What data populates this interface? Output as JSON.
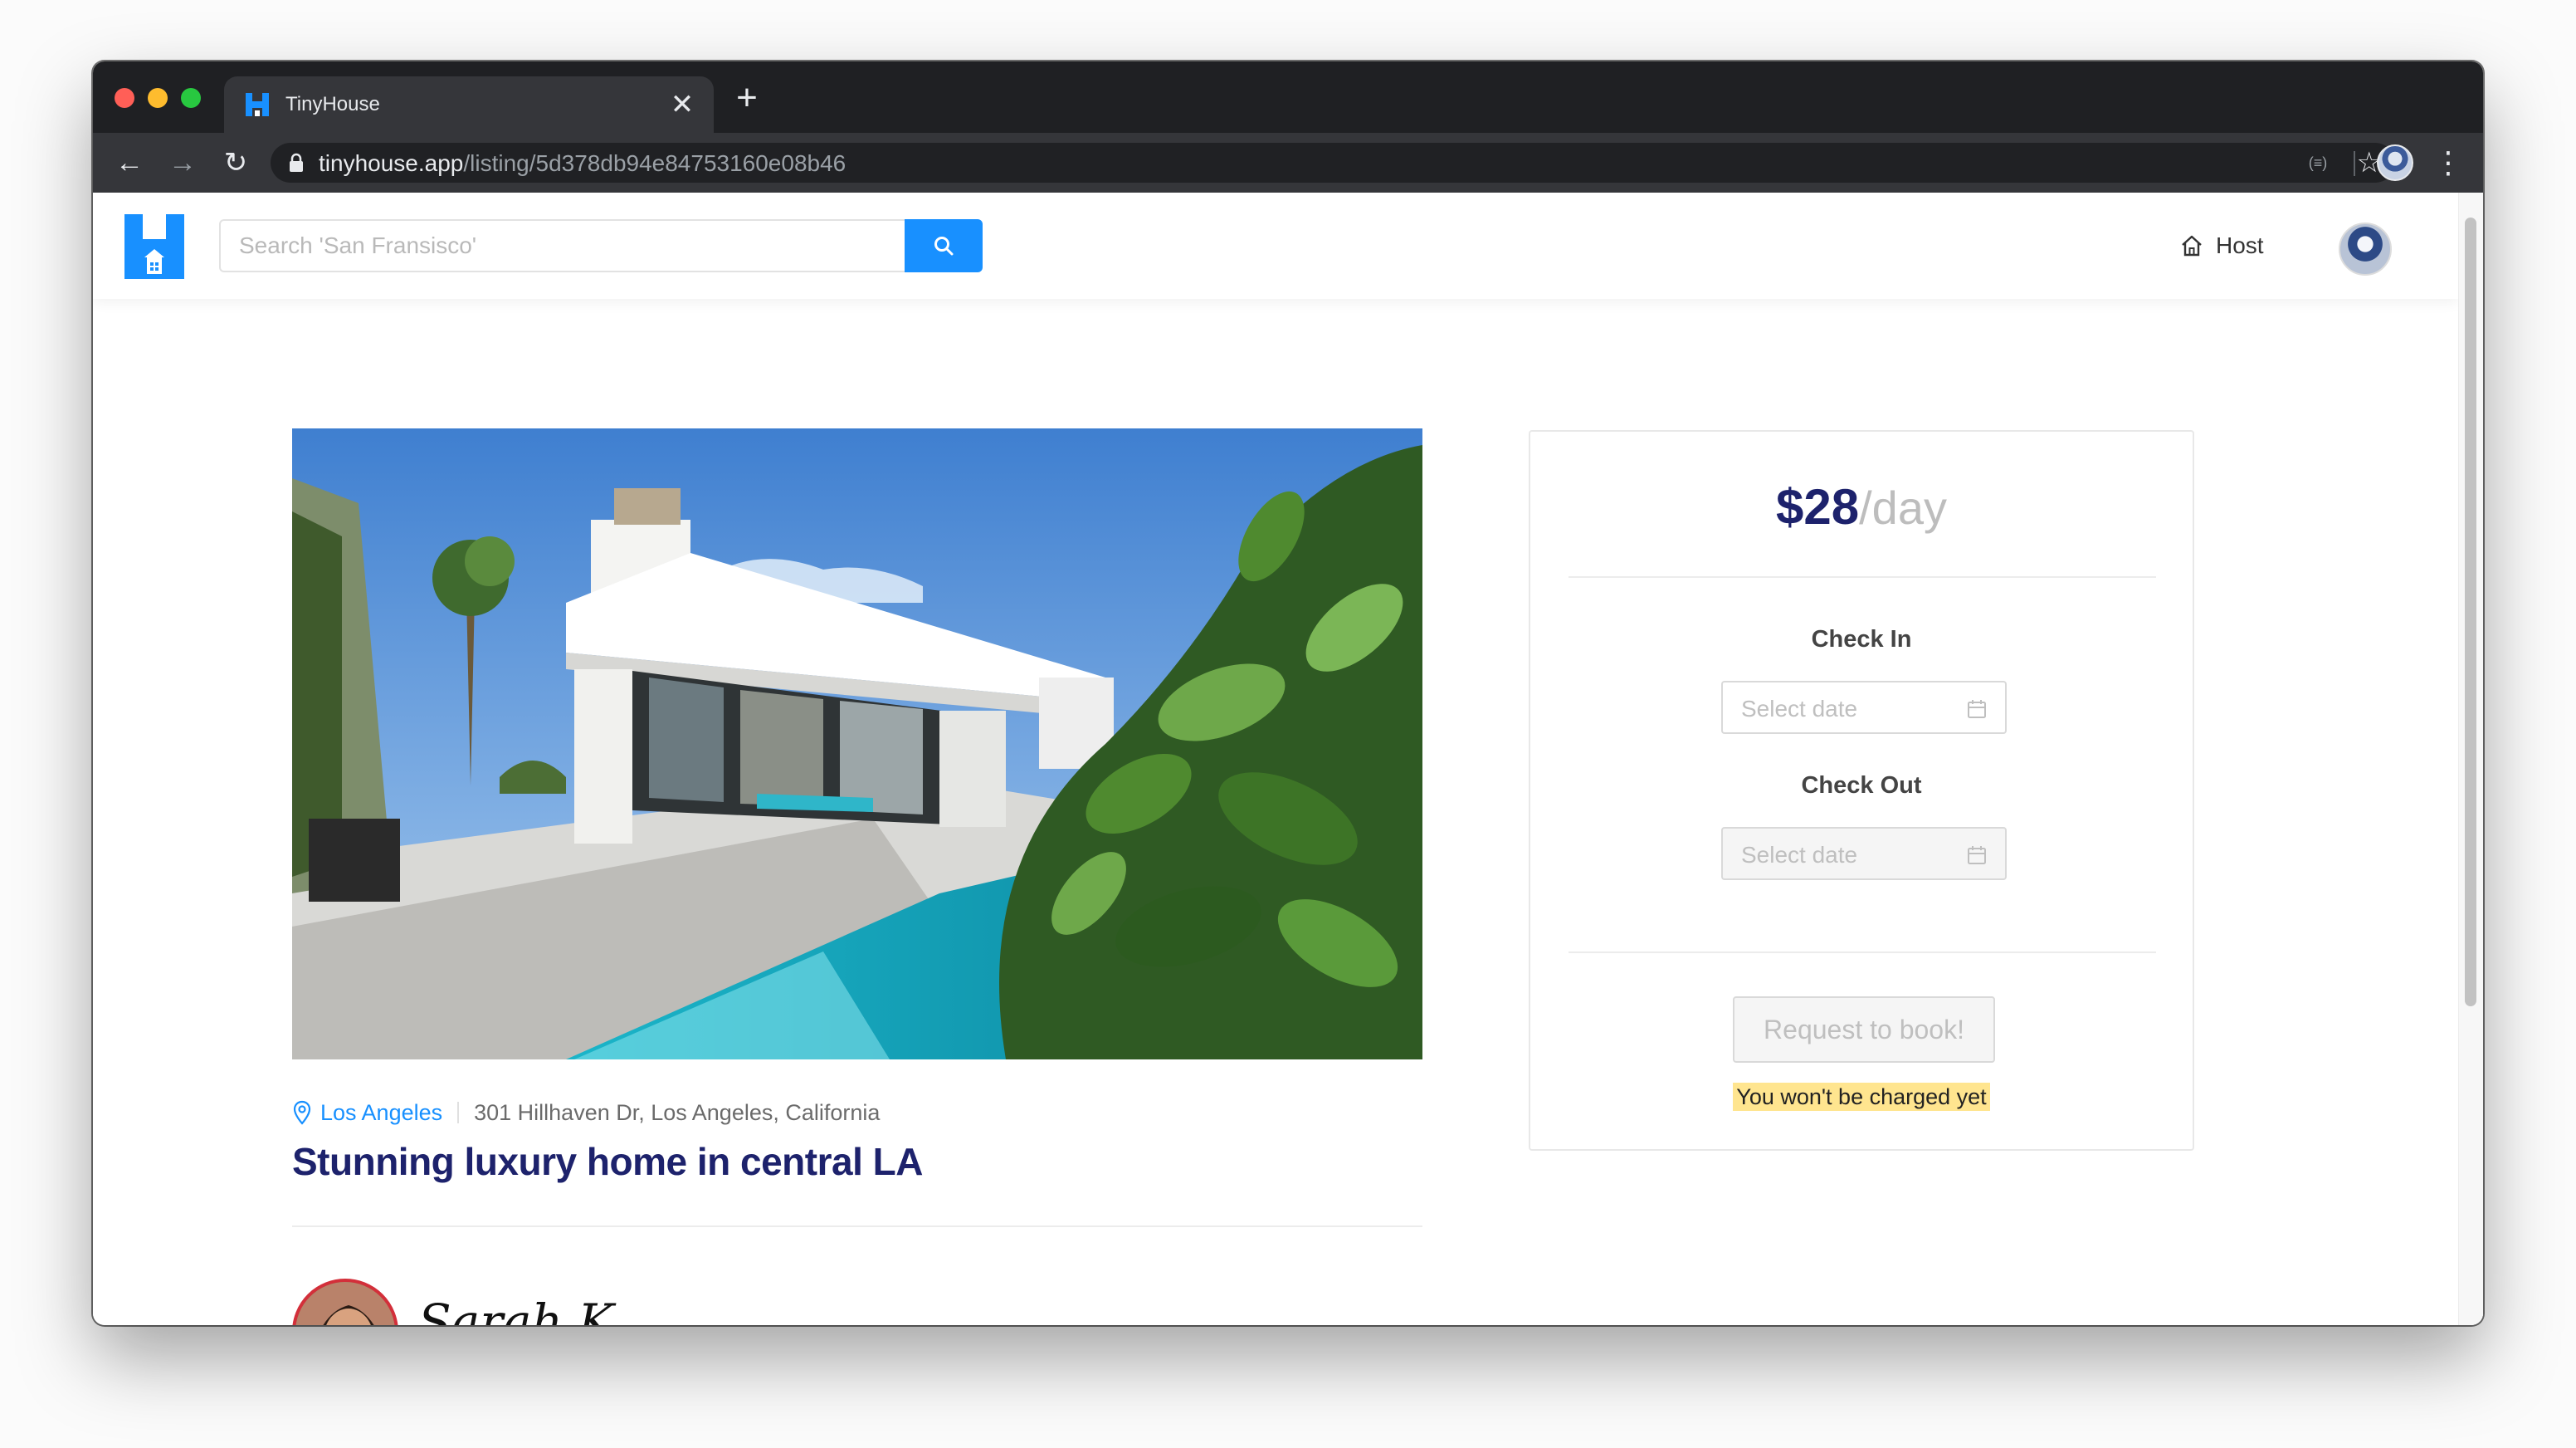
{
  "browser": {
    "tab_title": "TinyHouse",
    "tab_close": "✕",
    "new_tab": "+",
    "url_host": "tinyhouse.app",
    "url_path": "/listing/5d378db94e84753160e08b46",
    "back_glyph": "←",
    "forward_glyph": "→",
    "reload_glyph": "↻",
    "star_glyph": "☆",
    "menu_glyph": "⋮",
    "ext_glyph": "(≡)"
  },
  "header": {
    "search_placeholder": "Search 'San Fransisco'",
    "host_label": "Host"
  },
  "listing": {
    "city": "Los Angeles",
    "address": "301 Hillhaven Dr, Los Angeles, California",
    "title": "Stunning luxury home in central LA",
    "host_name": "Sarah K."
  },
  "booking": {
    "price": "$28",
    "price_unit": "/day",
    "check_in_label": "Check In",
    "check_out_label": "Check Out",
    "date_placeholder": "Select date",
    "book_button": "Request to book!",
    "charge_note": "You won't be charged yet"
  },
  "colors": {
    "brand_blue": "#1890ff",
    "title_navy": "#1d226c",
    "highlight": "#ffe58f"
  },
  "icons": {
    "search": "search-icon",
    "host": "home-icon",
    "location": "map-pin-icon",
    "calendar": "calendar-icon",
    "lock": "lock-icon"
  }
}
